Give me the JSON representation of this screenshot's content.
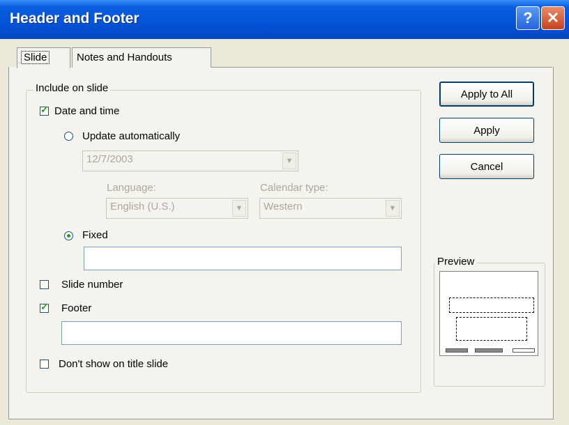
{
  "window": {
    "title": "Header and Footer"
  },
  "title_buttons": {
    "help": "?",
    "close": "✕"
  },
  "tabs": [
    {
      "label": "Slide"
    },
    {
      "label": "Notes and Handouts"
    }
  ],
  "group": {
    "legend": "Include on slide",
    "date_time": {
      "label": "Date and time",
      "checked": true
    },
    "update_automatically": {
      "label": "Update automatically",
      "selected": false
    },
    "date_combo": {
      "value": "12/7/2003"
    },
    "language": {
      "label": "Language:",
      "value": "English (U.S.)"
    },
    "calendar": {
      "label": "Calendar type:",
      "value": "Western"
    },
    "fixed": {
      "label": "Fixed",
      "selected": true,
      "value": ""
    },
    "slide_number": {
      "label": "Slide number",
      "checked": false
    },
    "footer": {
      "label": "Footer",
      "checked": true,
      "value": ""
    }
  },
  "dont_show": {
    "label": "Don't show on title slide",
    "checked": false
  },
  "buttons": {
    "apply_all": "Apply to All",
    "apply": "Apply",
    "cancel": "Cancel"
  },
  "preview": {
    "legend": "Preview"
  }
}
